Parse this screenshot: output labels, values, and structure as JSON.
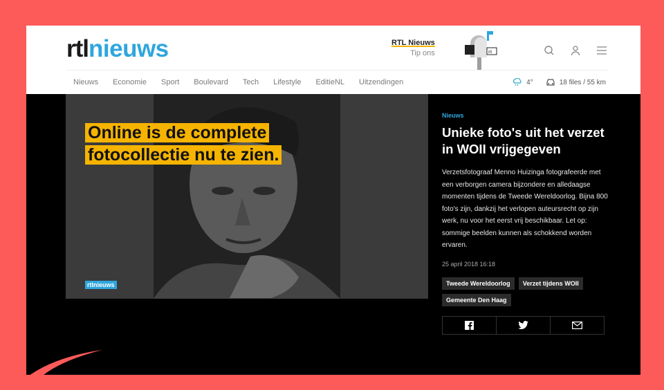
{
  "header": {
    "logo_rtl": "rtl",
    "logo_nieuws": "nieuws",
    "tip_brand": "RTL Nieuws",
    "tip_sub": "Tip ons",
    "icons": [
      "search-icon",
      "user-icon",
      "menu-icon"
    ]
  },
  "nav": {
    "items": [
      "Nieuws",
      "Economie",
      "Sport",
      "Boulevard",
      "Tech",
      "Lifestyle",
      "EditieNL",
      "Uitzendingen"
    ]
  },
  "status": {
    "weather": "4°",
    "traffic": "18 files / 55 km"
  },
  "hero": {
    "overlay_line1": "Online is de complete",
    "overlay_line2": "fotocollectie nu te zien.",
    "watermark": "rtlnieuws"
  },
  "article": {
    "category": "Nieuws",
    "title": "Unieke foto's uit het verzet in WOII vrijgegeven",
    "description": "Verzetsfotograaf Menno Huizinga fotografeerde met een verborgen camera bijzondere en alledaagse momenten tijdens de Tweede Wereldoorlog. Bijna 800 foto's zijn, dankzij het verlopen auteursrecht op zijn werk, nu voor het eerst vrij beschikbaar. Let op: sommige beelden kunnen als schokkend worden ervaren.",
    "date": "25 april 2018 16:18",
    "tags": [
      "Tweede Wereldoorlog",
      "Verzet tijdens WOII",
      "Gemeente Den Haag"
    ],
    "share": [
      "facebook-icon",
      "twitter-icon",
      "mail-icon"
    ]
  },
  "colors": {
    "frame": "#fd5a5a",
    "brand": "#2fa6dd",
    "highlight": "#f6b400"
  }
}
